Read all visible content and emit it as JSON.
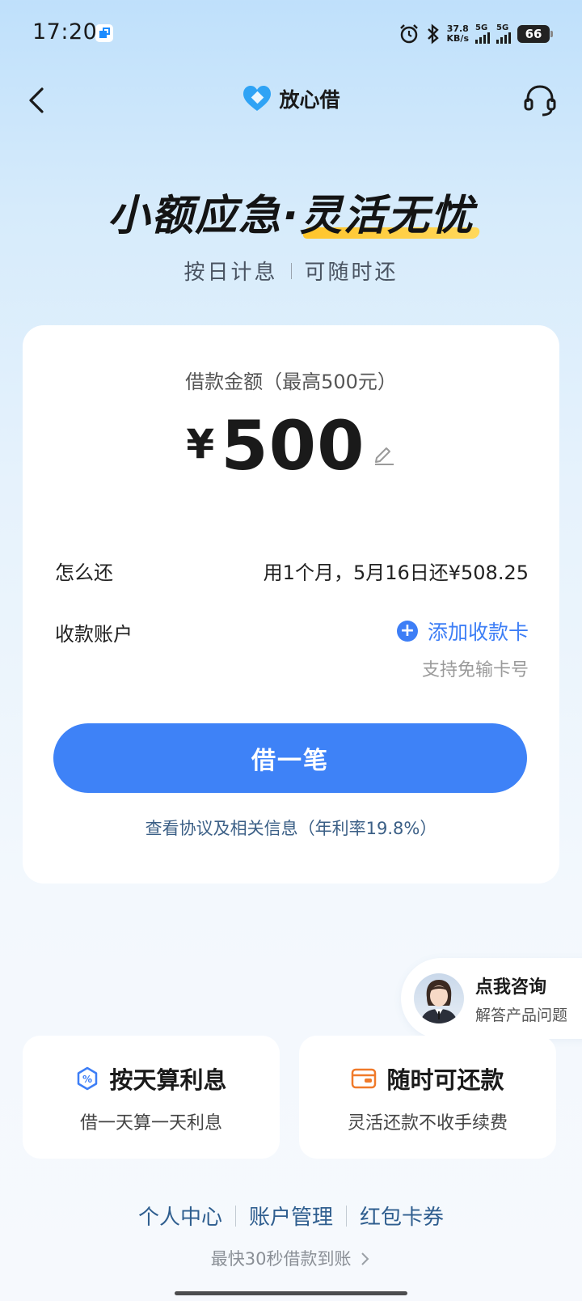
{
  "status_bar": {
    "time": "17:20",
    "net_speed_value": "37.8",
    "net_speed_unit": "KB/s",
    "sim1": "5G",
    "sim2": "5G",
    "battery": "66",
    "icons": [
      "alarm-icon",
      "bluetooth-icon",
      "signal-icon",
      "battery-icon"
    ]
  },
  "nav": {
    "brand_name": "放心借",
    "back_icon": "chevron-left-icon",
    "service_icon": "headset-icon"
  },
  "hero": {
    "title_part1": "小额应急·",
    "title_part2": "灵活无忧",
    "sub_left": "按日计息",
    "sub_right": "可随时还"
  },
  "loan_card": {
    "amount_label": "借款金额（最高500元）",
    "currency": "¥",
    "amount": "500",
    "repay_label": "怎么还",
    "repay_value": "用1个月，5月16日还¥508.25",
    "account_label": "收款账户",
    "add_card_label": "添加收款卡",
    "add_card_hint": "支持免输卡号",
    "borrow_button": "借一笔",
    "agreement_link": "查看协议及相关信息（年利率19.8%）"
  },
  "consult": {
    "title": "点我咨询",
    "subtitle": "解答产品问题"
  },
  "features": [
    {
      "icon": "percent-icon",
      "title": "按天算利息",
      "desc": "借一天算一天利息"
    },
    {
      "icon": "wallet-icon",
      "title": "随时可还款",
      "desc": "灵活还款不收手续费"
    }
  ],
  "bottom_links": [
    "个人中心",
    "账户管理",
    "红包卡券"
  ],
  "speed_note": "最快30秒借款到账",
  "colors": {
    "accent": "#3e82f7",
    "link": "#2f5e8f",
    "highlight": "#ffc52b",
    "wallet_icon": "#f07a2a"
  }
}
